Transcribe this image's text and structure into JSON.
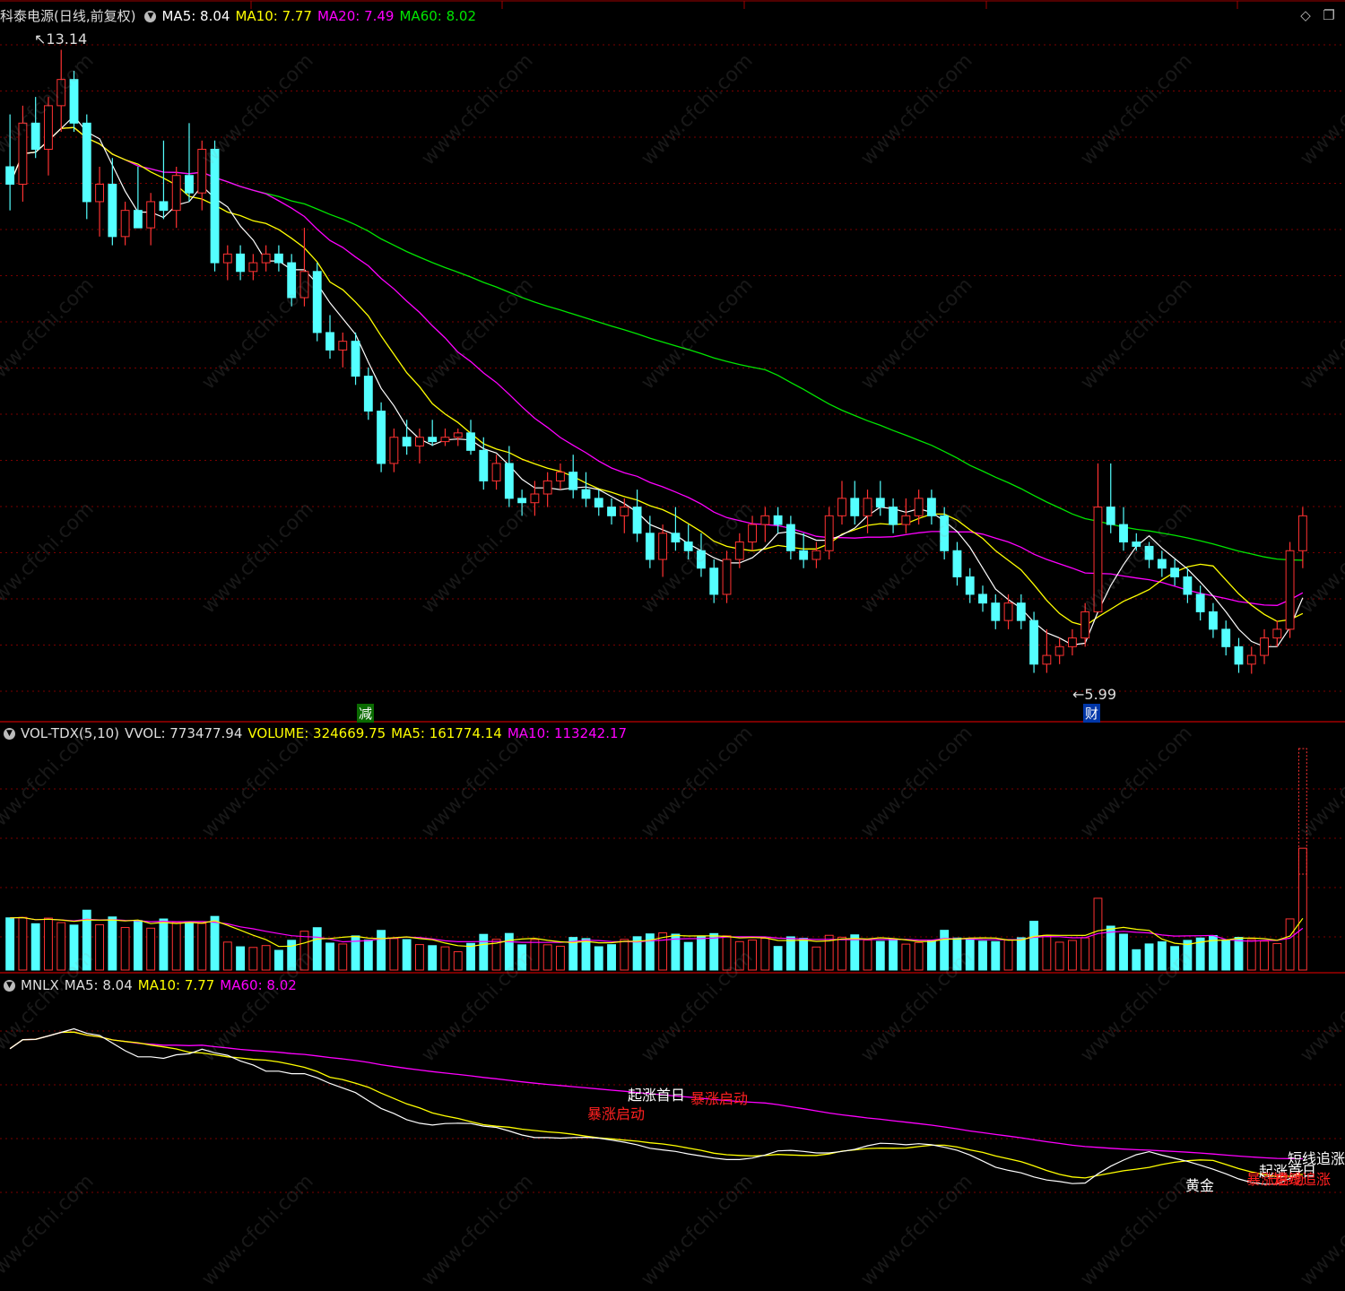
{
  "main_header": {
    "title": "科泰电源(日线,前复权)",
    "ma5": "MA5: 8.04",
    "ma10": "MA10: 7.77",
    "ma20": "MA20: 7.49",
    "ma60": "MA60: 8.02"
  },
  "vol_header": {
    "title": "VOL-TDX(5,10)",
    "vvol": "VVOL: 773477.94",
    "volume": "VOLUME: 324669.75",
    "ma5": "MA5: 161774.14",
    "ma10": "MA10: 113242.17"
  },
  "mnlx_header": {
    "title": "MNLX",
    "ma5": "MA5: 8.04",
    "ma10": "MA10: 7.77",
    "ma60": "MA60: 8.02"
  },
  "annotations": {
    "high": "13.14",
    "low": "5.99",
    "mark_jian": "减",
    "mark_cai": "财"
  },
  "signals": {
    "qizhang_1": "起涨首日",
    "baozhang_1": "暴涨启动",
    "baozhang_2": "暴涨启动",
    "huangjin": "黄金",
    "duanxian": "短线追涨",
    "qizhang_2": "起涨首日",
    "baozhang_3": "暴涨启动",
    "duanxian_2": "短线追涨"
  },
  "watermark": "www.cfchi.com",
  "colors": {
    "up": "#ff3232",
    "down": "#54ffff",
    "ma5": "#ffffff",
    "ma10": "#ffff00",
    "ma20": "#ff00ff",
    "ma60": "#00e600",
    "grid": "#7a0000"
  },
  "chart_data": {
    "type": "candlestick",
    "price_range": [
      5.99,
      13.14
    ],
    "ohlc": [
      [
        11.8,
        12.4,
        11.3,
        11.6
      ],
      [
        11.6,
        12.5,
        11.4,
        12.3
      ],
      [
        12.3,
        12.6,
        11.9,
        12.0
      ],
      [
        12.0,
        12.6,
        11.7,
        12.5
      ],
      [
        12.5,
        13.14,
        12.2,
        12.8
      ],
      [
        12.8,
        12.9,
        12.2,
        12.3
      ],
      [
        12.3,
        12.4,
        11.2,
        11.4
      ],
      [
        11.4,
        11.8,
        11.0,
        11.6
      ],
      [
        11.6,
        11.9,
        10.9,
        11.0
      ],
      [
        11.0,
        11.4,
        10.9,
        11.3
      ],
      [
        11.3,
        11.8,
        11.1,
        11.1
      ],
      [
        11.1,
        11.5,
        10.9,
        11.4
      ],
      [
        11.4,
        12.1,
        11.2,
        11.3
      ],
      [
        11.3,
        11.8,
        11.1,
        11.7
      ],
      [
        11.7,
        12.3,
        11.4,
        11.5
      ],
      [
        11.5,
        12.1,
        11.3,
        12.0
      ],
      [
        12.0,
        12.1,
        10.6,
        10.7
      ],
      [
        10.7,
        10.9,
        10.5,
        10.8
      ],
      [
        10.8,
        10.9,
        10.5,
        10.6
      ],
      [
        10.6,
        10.8,
        10.5,
        10.7
      ],
      [
        10.7,
        10.9,
        10.6,
        10.8
      ],
      [
        10.8,
        10.9,
        10.6,
        10.7
      ],
      [
        10.7,
        10.8,
        10.2,
        10.3
      ],
      [
        10.3,
        11.1,
        10.2,
        10.6
      ],
      [
        10.6,
        10.7,
        9.8,
        9.9
      ],
      [
        9.9,
        10.1,
        9.6,
        9.7
      ],
      [
        9.7,
        9.9,
        9.5,
        9.8
      ],
      [
        9.8,
        9.9,
        9.3,
        9.4
      ],
      [
        9.4,
        9.5,
        8.9,
        9.0
      ],
      [
        9.0,
        9.1,
        8.3,
        8.4
      ],
      [
        8.4,
        8.8,
        8.3,
        8.7
      ],
      [
        8.7,
        8.9,
        8.5,
        8.6
      ],
      [
        8.6,
        8.8,
        8.4,
        8.7
      ],
      [
        8.7,
        8.9,
        8.6,
        8.65
      ],
      [
        8.65,
        8.8,
        8.6,
        8.7
      ],
      [
        8.7,
        8.8,
        8.6,
        8.75
      ],
      [
        8.75,
        8.9,
        8.5,
        8.55
      ],
      [
        8.55,
        8.7,
        8.1,
        8.2
      ],
      [
        8.2,
        8.5,
        8.1,
        8.4
      ],
      [
        8.4,
        8.6,
        7.9,
        8.0
      ],
      [
        8.0,
        8.1,
        7.8,
        7.95
      ],
      [
        7.95,
        8.2,
        7.8,
        8.05
      ],
      [
        8.05,
        8.3,
        7.9,
        8.2
      ],
      [
        8.2,
        8.4,
        8.1,
        8.3
      ],
      [
        8.3,
        8.5,
        8.0,
        8.1
      ],
      [
        8.1,
        8.3,
        7.9,
        8.0
      ],
      [
        8.0,
        8.1,
        7.8,
        7.9
      ],
      [
        7.9,
        8.0,
        7.7,
        7.8
      ],
      [
        7.8,
        8.0,
        7.6,
        7.9
      ],
      [
        7.9,
        8.1,
        7.5,
        7.6
      ],
      [
        7.6,
        7.8,
        7.2,
        7.3
      ],
      [
        7.3,
        7.7,
        7.1,
        7.6
      ],
      [
        7.6,
        7.9,
        7.4,
        7.5
      ],
      [
        7.5,
        7.7,
        7.3,
        7.4
      ],
      [
        7.4,
        7.6,
        7.1,
        7.2
      ],
      [
        7.2,
        7.3,
        6.8,
        6.9
      ],
      [
        6.9,
        7.4,
        6.8,
        7.3
      ],
      [
        7.3,
        7.6,
        7.2,
        7.5
      ],
      [
        7.5,
        7.8,
        7.4,
        7.7
      ],
      [
        7.7,
        7.9,
        7.5,
        7.8
      ],
      [
        7.8,
        7.9,
        7.6,
        7.7
      ],
      [
        7.7,
        7.8,
        7.3,
        7.4
      ],
      [
        7.4,
        7.6,
        7.2,
        7.3
      ],
      [
        7.3,
        7.5,
        7.2,
        7.4
      ],
      [
        7.4,
        7.9,
        7.3,
        7.8
      ],
      [
        7.8,
        8.2,
        7.7,
        8.0
      ],
      [
        8.0,
        8.2,
        7.7,
        7.8
      ],
      [
        7.8,
        8.1,
        7.6,
        8.0
      ],
      [
        8.0,
        8.2,
        7.8,
        7.9
      ],
      [
        7.9,
        8.0,
        7.6,
        7.7
      ],
      [
        7.7,
        8.0,
        7.6,
        7.8
      ],
      [
        7.8,
        8.1,
        7.7,
        8.0
      ],
      [
        8.0,
        8.1,
        7.7,
        7.8
      ],
      [
        7.8,
        7.9,
        7.3,
        7.4
      ],
      [
        7.4,
        7.5,
        7.0,
        7.1
      ],
      [
        7.1,
        7.2,
        6.8,
        6.9
      ],
      [
        6.9,
        7.0,
        6.7,
        6.8
      ],
      [
        6.8,
        6.9,
        6.5,
        6.6
      ],
      [
        6.6,
        6.9,
        6.5,
        6.8
      ],
      [
        6.8,
        6.9,
        6.5,
        6.6
      ],
      [
        6.6,
        6.7,
        6.0,
        6.1
      ],
      [
        6.1,
        6.5,
        6.0,
        6.2
      ],
      [
        6.2,
        6.4,
        6.1,
        6.3
      ],
      [
        6.3,
        6.5,
        6.2,
        6.4
      ],
      [
        6.4,
        6.8,
        6.3,
        6.7
      ],
      [
        6.7,
        8.4,
        6.7,
        7.9
      ],
      [
        7.9,
        8.4,
        7.6,
        7.7
      ],
      [
        7.7,
        7.9,
        7.4,
        7.5
      ],
      [
        7.5,
        7.6,
        7.4,
        7.45
      ],
      [
        7.45,
        7.5,
        7.2,
        7.3
      ],
      [
        7.3,
        7.4,
        7.1,
        7.2
      ],
      [
        7.2,
        7.3,
        7.0,
        7.1
      ],
      [
        7.1,
        7.2,
        6.8,
        6.9
      ],
      [
        6.9,
        7.0,
        6.6,
        6.7
      ],
      [
        6.7,
        6.8,
        6.4,
        6.5
      ],
      [
        6.5,
        6.6,
        6.2,
        6.3
      ],
      [
        6.3,
        6.4,
        6.0,
        6.1
      ],
      [
        6.1,
        6.3,
        5.99,
        6.2
      ],
      [
        6.2,
        6.5,
        6.1,
        6.4
      ],
      [
        6.4,
        6.6,
        6.3,
        6.5
      ],
      [
        6.5,
        7.5,
        6.4,
        7.4
      ],
      [
        7.4,
        7.9,
        7.2,
        7.8
      ]
    ]
  }
}
